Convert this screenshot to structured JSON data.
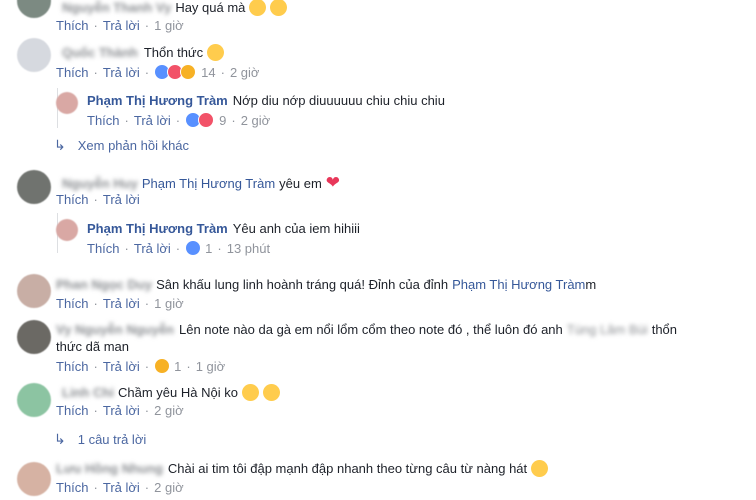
{
  "common": {
    "like": "Thích",
    "reply": "Trả lời",
    "dot": "·"
  },
  "c1": {
    "name": "Nguyễn Thanh Vy",
    "text": "Hay quá mà",
    "time": "1 giờ"
  },
  "c2": {
    "name": "Quốc Thành",
    "text": "Thổn thức",
    "count": "14",
    "time": "2 giờ"
  },
  "r1": {
    "name": "Phạm Thị Hương Tràm",
    "text": "Nớp diu nớp diuuuuuu chiu chiu chiu",
    "count": "9",
    "time": "2 giờ"
  },
  "more1": {
    "label": "Xem phản hồi khác"
  },
  "c3": {
    "name": "Nguyễn Huy",
    "mention": "Phạm Thị Hương Tràm",
    "text": "yêu em"
  },
  "r2": {
    "name": "Phạm Thị Hương Tràm",
    "text": "Yêu anh của iem hihiii",
    "count": "1",
    "time": "13 phút"
  },
  "c4": {
    "name": "Phan Ngọc Duy",
    "text": "Sân khấu lung linh hoành tráng quá! Đỉnh của đỉnh",
    "mention": "Phạm Thị Hương Tràm",
    "suffix": "m",
    "time": "1 giờ"
  },
  "c5": {
    "name": "Vy Nguyễn Nguyễn",
    "text1": "Lên note nào da gà em nổi lổm cổm theo note đó , thể luôn đó anh",
    "mention": "Tùng Lâm Bùi",
    "text1b": "thổn",
    "text2": "thức dã man",
    "count": "1",
    "time": "1 giờ"
  },
  "c6": {
    "name": "Linh Chi",
    "text": "Chầm yêu Hà Nội ko",
    "time": "2 giờ"
  },
  "more2": {
    "label": "1 câu trả lời"
  },
  "c7": {
    "name": "Lưu Hồng Nhung",
    "text": "Chài ai tim tôi đập mạnh đập nhanh theo từng câu từ nàng hát",
    "time": "2 giờ"
  }
}
